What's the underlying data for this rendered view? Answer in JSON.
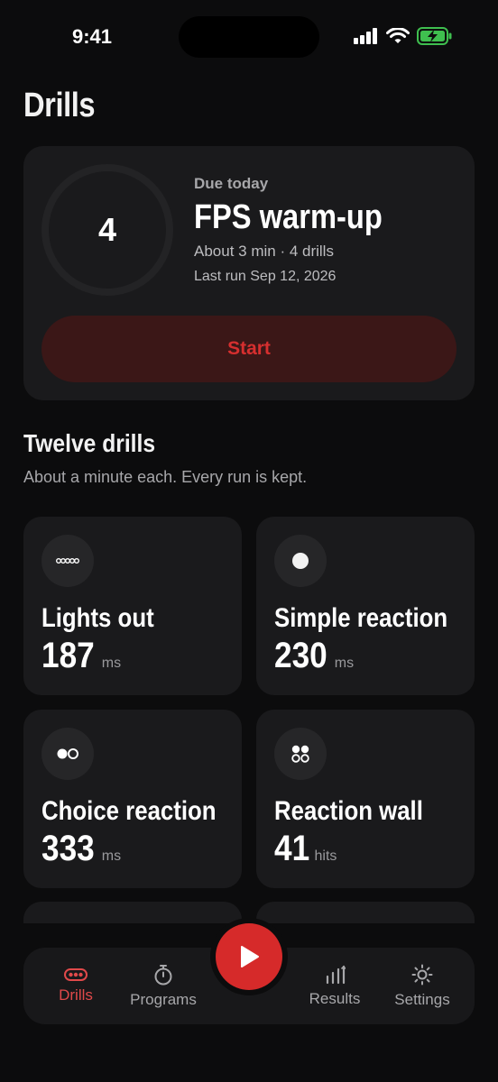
{
  "status": {
    "time": "9:41"
  },
  "page": {
    "title": "Drills"
  },
  "hero": {
    "count": "4",
    "due_label": "Due today",
    "title": "FPS warm-up",
    "subtitle": "About 3 min · 4 drills",
    "last_run": "Last run Sep 12, 2026",
    "start_label": "Start"
  },
  "section": {
    "title": "Twelve drills",
    "subtitle": "About a minute each. Every run is kept."
  },
  "drills": [
    {
      "name": "Lights out",
      "value": "187",
      "unit": "ms",
      "icon": "lights-out-icon"
    },
    {
      "name": "Simple reaction",
      "value": "230",
      "unit": "ms",
      "icon": "dot-icon"
    },
    {
      "name": "Choice reaction",
      "value": "333",
      "unit": "ms",
      "icon": "choice-dots-icon"
    },
    {
      "name": "Reaction wall",
      "value": "41",
      "unit": "hits",
      "icon": "grid-dots-icon"
    }
  ],
  "tabs": {
    "drills": "Drills",
    "programs": "Programs",
    "results": "Results",
    "settings": "Settings"
  },
  "colors": {
    "accent": "#d62a2a",
    "background": "#0c0c0d",
    "card": "#1a1a1c"
  }
}
